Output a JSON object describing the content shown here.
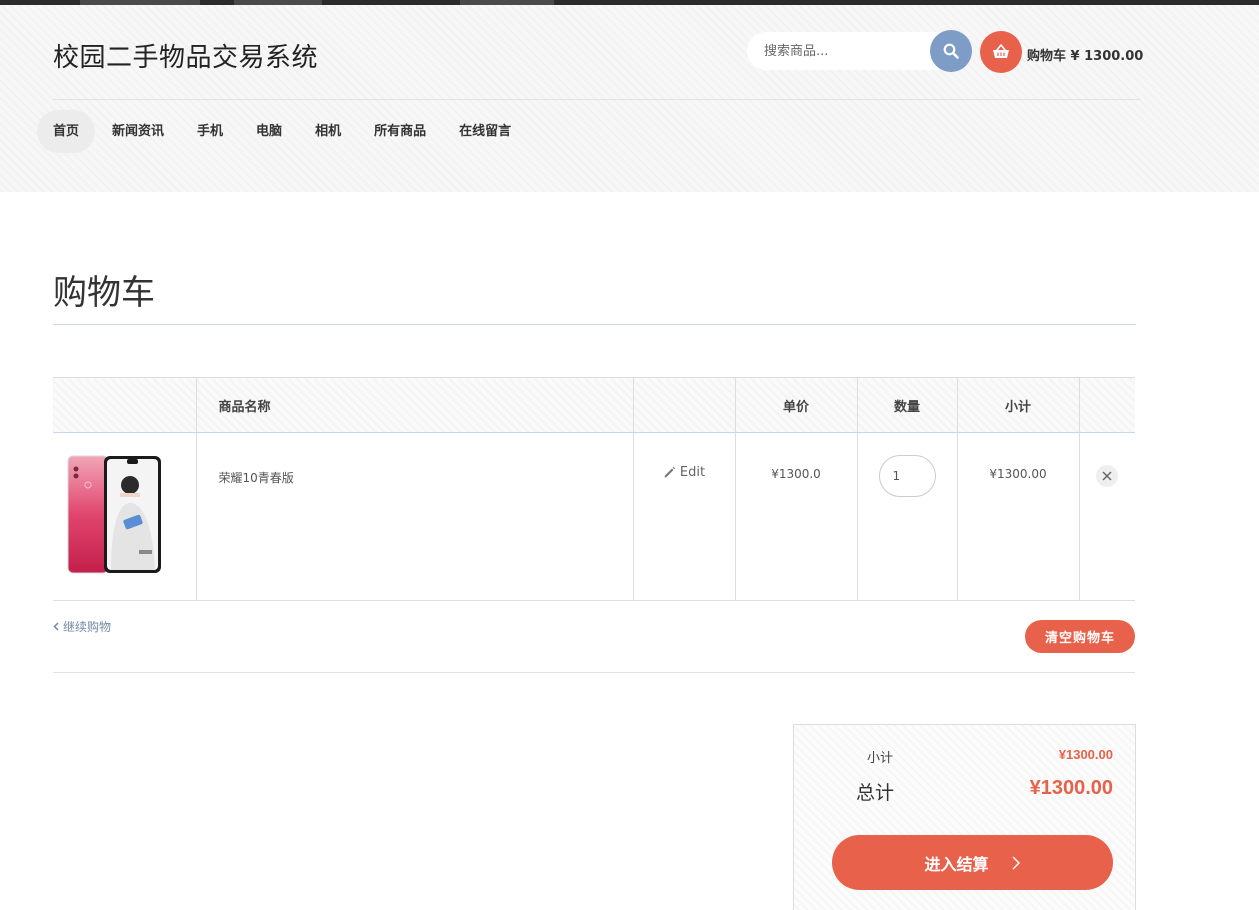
{
  "header": {
    "site_title": "校园二手物品交易系统",
    "search_placeholder": "搜索商品...",
    "cart_label": "购物车 ¥ 1300.00"
  },
  "nav": {
    "items": [
      {
        "label": "首页",
        "active": true
      },
      {
        "label": "新闻资讯",
        "active": false
      },
      {
        "label": "手机",
        "active": false
      },
      {
        "label": "电脑",
        "active": false
      },
      {
        "label": "相机",
        "active": false
      },
      {
        "label": "所有商品",
        "active": false
      },
      {
        "label": "在线留言",
        "active": false
      }
    ]
  },
  "page": {
    "title": "购物车"
  },
  "table": {
    "headers": {
      "image": "",
      "name": "商品名称",
      "edit": "",
      "price": "单价",
      "qty": "数量",
      "subtotal": "小计",
      "remove": ""
    },
    "rows": [
      {
        "name": "荣耀10青春版",
        "edit_label": "Edit",
        "price": "¥1300.0",
        "qty": "1",
        "subtotal": "¥1300.00"
      }
    ]
  },
  "actions": {
    "continue_label": "继续购物",
    "clear_label": "清空购物车"
  },
  "totals": {
    "subtotal_label": "小计",
    "subtotal_value": "¥1300.00",
    "total_label": "总计",
    "total_value": "¥1300.00",
    "checkout_label": "进入结算"
  },
  "colors": {
    "accent": "#e8614a",
    "search_button": "#7d9cc6",
    "link": "#7289a6"
  },
  "icons": {
    "search": "search-icon",
    "cart": "basket-icon",
    "edit": "pencil-icon",
    "remove": "close-icon",
    "continue": "chevron-left-icon",
    "checkout": "chevron-right-icon"
  }
}
